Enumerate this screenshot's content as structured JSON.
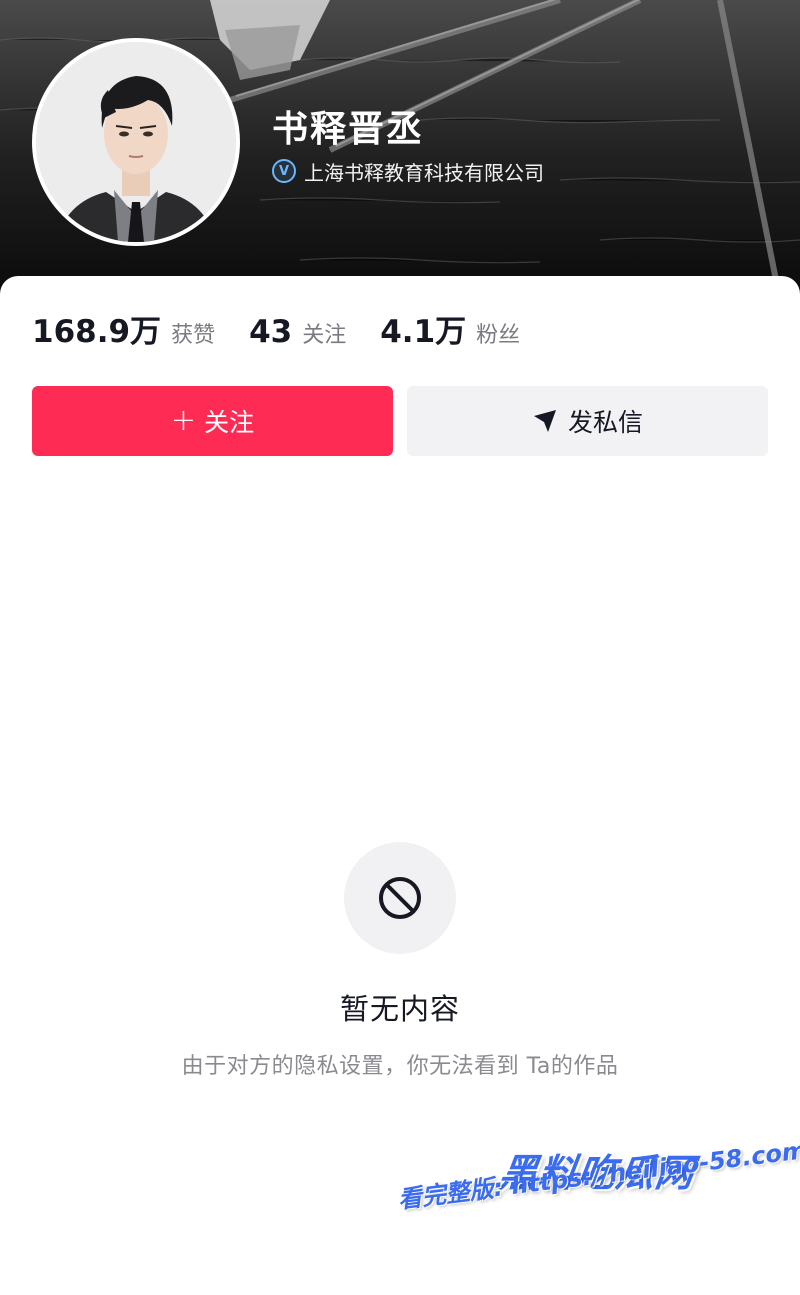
{
  "profile": {
    "name": "书释晋丞",
    "certification": "上海书释教育科技有限公司",
    "cert_badge": "V"
  },
  "stats": [
    {
      "value": "168.9万",
      "label": "获赞"
    },
    {
      "value": "43",
      "label": "关注"
    },
    {
      "value": "4.1万",
      "label": "粉丝"
    }
  ],
  "actions": {
    "follow_icon": "+",
    "follow_label": "关注",
    "message_label": "发私信"
  },
  "empty_state": {
    "icon": "no-entry-icon",
    "title": "暂无内容",
    "description": "由于对方的隐私设置，你无法看到 Ta的作品"
  },
  "watermark": {
    "line1": "黑料吃瓜网",
    "line2": "看完整版: https://heiliao-58.com"
  },
  "colors": {
    "primary": "#fe2c55",
    "cert_blue": "#6ab6ff",
    "text_main": "#161823",
    "text_sub": "#7a7b82"
  }
}
